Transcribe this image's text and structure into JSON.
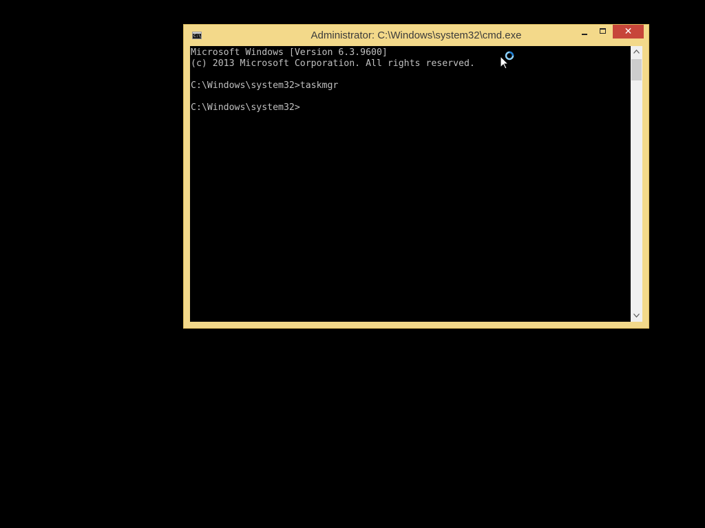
{
  "window": {
    "title": "Administrator: C:\\Windows\\system32\\cmd.exe",
    "icon": "cmd-icon",
    "icon_text": "C:\\",
    "frame_color": "#f3d98a",
    "controls": {
      "minimize": "minimize-icon",
      "maximize": "maximize-icon",
      "close_label": "✕",
      "close_color": "#c7463a"
    }
  },
  "console": {
    "lines": [
      "Microsoft Windows [Version 6.3.9600]",
      "(c) 2013 Microsoft Corporation. All rights reserved.",
      "",
      "C:\\Windows\\system32>taskmgr",
      "",
      "C:\\Windows\\system32>"
    ],
    "text_color": "#c0c0c0",
    "background": "#000000"
  },
  "scrollbar": {
    "up_icon": "chevron-up-icon",
    "down_icon": "chevron-down-icon"
  },
  "pointer": {
    "icon": "busy-cursor-icon"
  }
}
